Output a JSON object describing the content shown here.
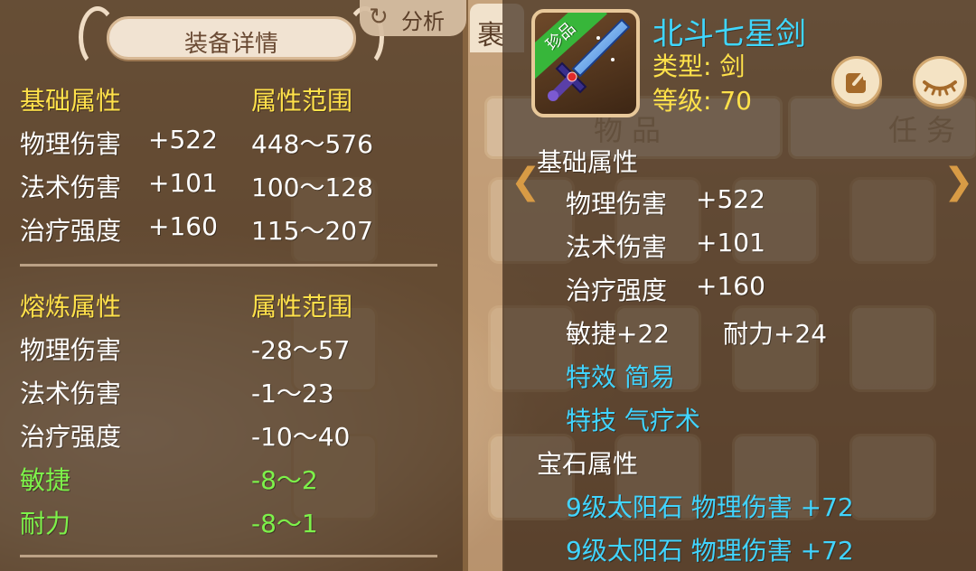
{
  "analyze_button": {
    "icon": "refresh-icon",
    "label": "分析"
  },
  "bag_tab": {
    "label": "裹"
  },
  "inventory_tabs": {
    "items": "物品",
    "tasks": "任务"
  },
  "detail_panel": {
    "title": "装备详情",
    "base_header": "基础属性",
    "range_header": "属性范围",
    "base_stats": [
      {
        "name": "物理伤害",
        "value": "+522",
        "range": "448～576"
      },
      {
        "name": "法术伤害",
        "value": "+101",
        "range": "100～128"
      },
      {
        "name": "治疗强度",
        "value": "+160",
        "range": "115～207"
      }
    ],
    "refine_header": "熔炼属性",
    "refine_range_header": "属性范围",
    "refine_stats": [
      {
        "name": "物理伤害",
        "range": "-28～57",
        "highlight": false
      },
      {
        "name": "法术伤害",
        "range": "-1～23",
        "highlight": false
      },
      {
        "name": "治疗强度",
        "range": "-10～40",
        "highlight": false
      },
      {
        "name": "敏捷",
        "range": "-8～2",
        "highlight": true
      },
      {
        "name": "耐力",
        "range": "-8～1",
        "highlight": true
      }
    ]
  },
  "item": {
    "rarity": "珍品",
    "name": "北斗七星剑",
    "type_line": "类型: 剑",
    "level_line": "等级: 70",
    "base_header": "基础属性",
    "base_stats": [
      {
        "name": "物理伤害",
        "value": "+522"
      },
      {
        "name": "法术伤害",
        "value": "+101"
      },
      {
        "name": "治疗强度",
        "value": "+160"
      }
    ],
    "bonus_stats": [
      "敏捷+22",
      "耐力+24"
    ],
    "effect_line": "特效  简易",
    "skill_line": "特技  气疗术",
    "gem_header": "宝石属性",
    "gems": [
      "9级太阳石  物理伤害  +72",
      "9级太阳石  物理伤害  +72"
    ]
  },
  "colors": {
    "header_yellow": "#ffe14a",
    "bonus_green": "#7df24a",
    "cyan_text": "#41d4ff",
    "item_name": "#3fd7ff"
  }
}
